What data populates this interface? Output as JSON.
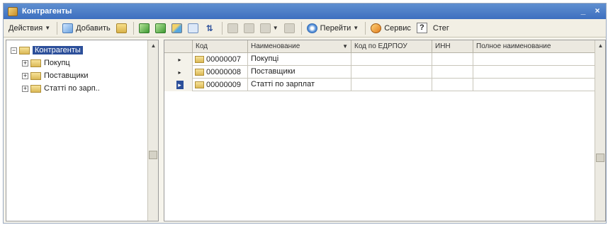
{
  "window": {
    "title": "Контрагенты",
    "minimize_label": "_",
    "close_label": "×"
  },
  "toolbar": {
    "actions_label": "Действия",
    "add_label": "Добавить",
    "goto_label": "Перейти",
    "services_label": "Сервис",
    "help_label": "?",
    "extra_label": "Стег"
  },
  "tree": {
    "root_label": "Контрагенты",
    "items": [
      {
        "label": "Покупц"
      },
      {
        "label": "Поставщики"
      },
      {
        "label": "Статті по зарп.."
      }
    ]
  },
  "grid": {
    "columns": [
      "Код",
      "Наименование",
      "Код по ЕДРПОУ",
      "ИНН",
      "Полное наименование"
    ],
    "rows": [
      {
        "marker": "▸",
        "code": "00000007",
        "name": "Покупці",
        "edrpou": "",
        "inn": "",
        "full": ""
      },
      {
        "marker": "▸",
        "code": "00000008",
        "name": "Поставщики",
        "edrpou": "",
        "inn": "",
        "full": ""
      },
      {
        "marker": "▸",
        "code": "00000009",
        "name": "Статті по зарплат",
        "edrpou": "",
        "inn": "",
        "full": ""
      }
    ]
  },
  "colors": {
    "titlebar": "#3d6fbf",
    "selection": "#2c4f9a"
  }
}
